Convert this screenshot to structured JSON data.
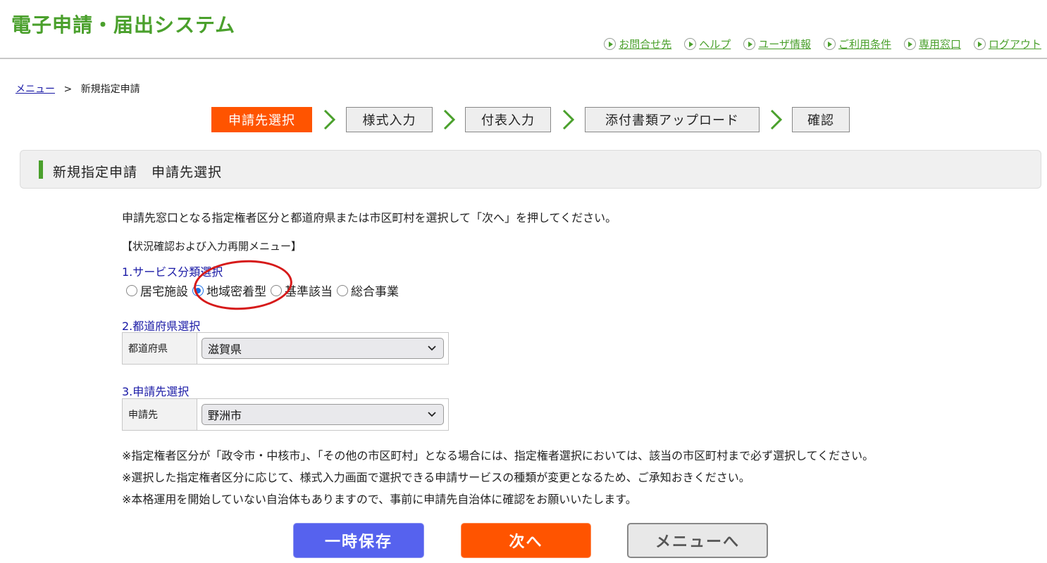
{
  "header": {
    "title": "電子申請・届出システム",
    "links": [
      {
        "label": "お問合せ先",
        "icon": "play-circle-icon"
      },
      {
        "label": "ヘルプ",
        "icon": "play-circle-icon"
      },
      {
        "label": "ユーザ情報",
        "icon": "play-circle-icon"
      },
      {
        "label": "ご利用条件",
        "icon": "play-circle-icon"
      },
      {
        "label": "専用窓口",
        "icon": "play-circle-icon"
      },
      {
        "label": "ログアウト",
        "icon": "play-circle-icon"
      }
    ]
  },
  "breadcrumb": {
    "menu": "メニュー",
    "separator": ">",
    "current": "新規指定申請"
  },
  "steps": [
    {
      "label": "申請先選択",
      "active": true
    },
    {
      "label": "様式入力",
      "active": false
    },
    {
      "label": "付表入力",
      "active": false
    },
    {
      "label": "添付書類アップロード",
      "active": false
    },
    {
      "label": "確認",
      "active": false
    }
  ],
  "section": {
    "title": "新規指定申請　申請先選択"
  },
  "content": {
    "instruction": "申請先窓口となる指定権者区分と都道府県または市区町村を選択して「次へ」を押してください。",
    "status_menu": "【状況確認および入力再開メニュー】",
    "service": {
      "label": "1.サービス分類選択",
      "options": [
        "居宅施設",
        "地域密着型",
        "基準該当",
        "総合事業"
      ],
      "selected": "地域密着型"
    },
    "prefecture": {
      "label": "2.都道府県選択",
      "field_label": "都道府県",
      "value": "滋賀県"
    },
    "applicant": {
      "label": "3.申請先選択",
      "field_label": "申請先",
      "value": "野洲市"
    },
    "notes": [
      "※指定権者区分が「政令市・中核市」、「その他の市区町村」となる場合には、指定権者選択においては、該当の市区町村まで必ず選択してください。",
      "※選択した指定権者区分に応じて、様式入力画面で選択できる申請サービスの種類が変更となるため、ご承知おきください。",
      "※本格運用を開始していない自治体もありますので、事前に申請先自治体に確認をお願いいたします。"
    ]
  },
  "buttons": {
    "save": "一時保存",
    "next": "次へ",
    "menu": "メニューへ"
  },
  "colors": {
    "brand_green": "#4aa02c",
    "active_orange": "#ff5400",
    "save_blue": "#5662ee",
    "link_blue": "#1a1aa6",
    "annotation_red": "#d61a1a"
  }
}
